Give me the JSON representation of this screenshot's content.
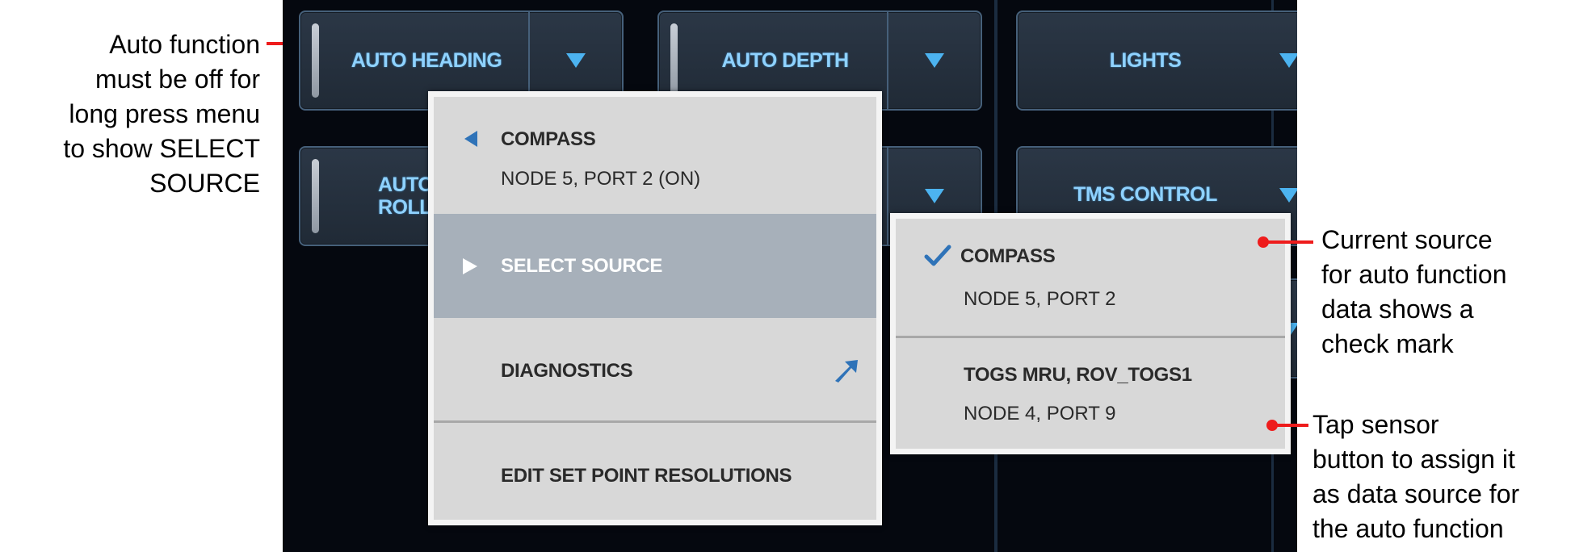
{
  "controls": {
    "auto_heading": "AUTO HEADING",
    "auto_depth": "AUTO DEPTH",
    "lights": "LIGHTS",
    "auto_roll_line1": "AUTO I",
    "auto_roll_line2": "ROLL",
    "tms_control": "TMS CONTROL"
  },
  "context_menu": {
    "header_title": "COMPASS",
    "header_subtitle": "NODE 5, PORT 2 (ON)",
    "select_source": "SELECT SOURCE",
    "diagnostics": "DIAGNOSTICS",
    "edit_set_point": "EDIT SET POINT RESOLUTIONS"
  },
  "source_menu": {
    "items": [
      {
        "title": "COMPASS",
        "subtitle": "NODE 5, PORT 2",
        "checked": true
      },
      {
        "title": "TOGS MRU, ROV_TOGS1",
        "subtitle": "NODE 4, PORT 9",
        "checked": false
      }
    ]
  },
  "annotations": {
    "left": [
      "Auto function",
      "must be off for",
      "long press menu",
      "to show SELECT",
      "SOURCE"
    ],
    "current_source": [
      "Current source",
      "for auto function",
      "data shows a",
      "check mark"
    ],
    "tap_sensor": [
      "Tap sensor",
      "button to assign it",
      "as data source for",
      "the auto function"
    ]
  },
  "colors": {
    "accent_text": "#8fd2ff",
    "accent_icon": "#4cb3f0",
    "selected_row": "#a7b0ba",
    "annotation_red": "#ee1c1c",
    "check_blue": "#2f73b8"
  },
  "icons": [
    "chevron-down-icon",
    "left-arrow-icon",
    "right-arrow-icon",
    "external-link-icon",
    "check-icon"
  ]
}
